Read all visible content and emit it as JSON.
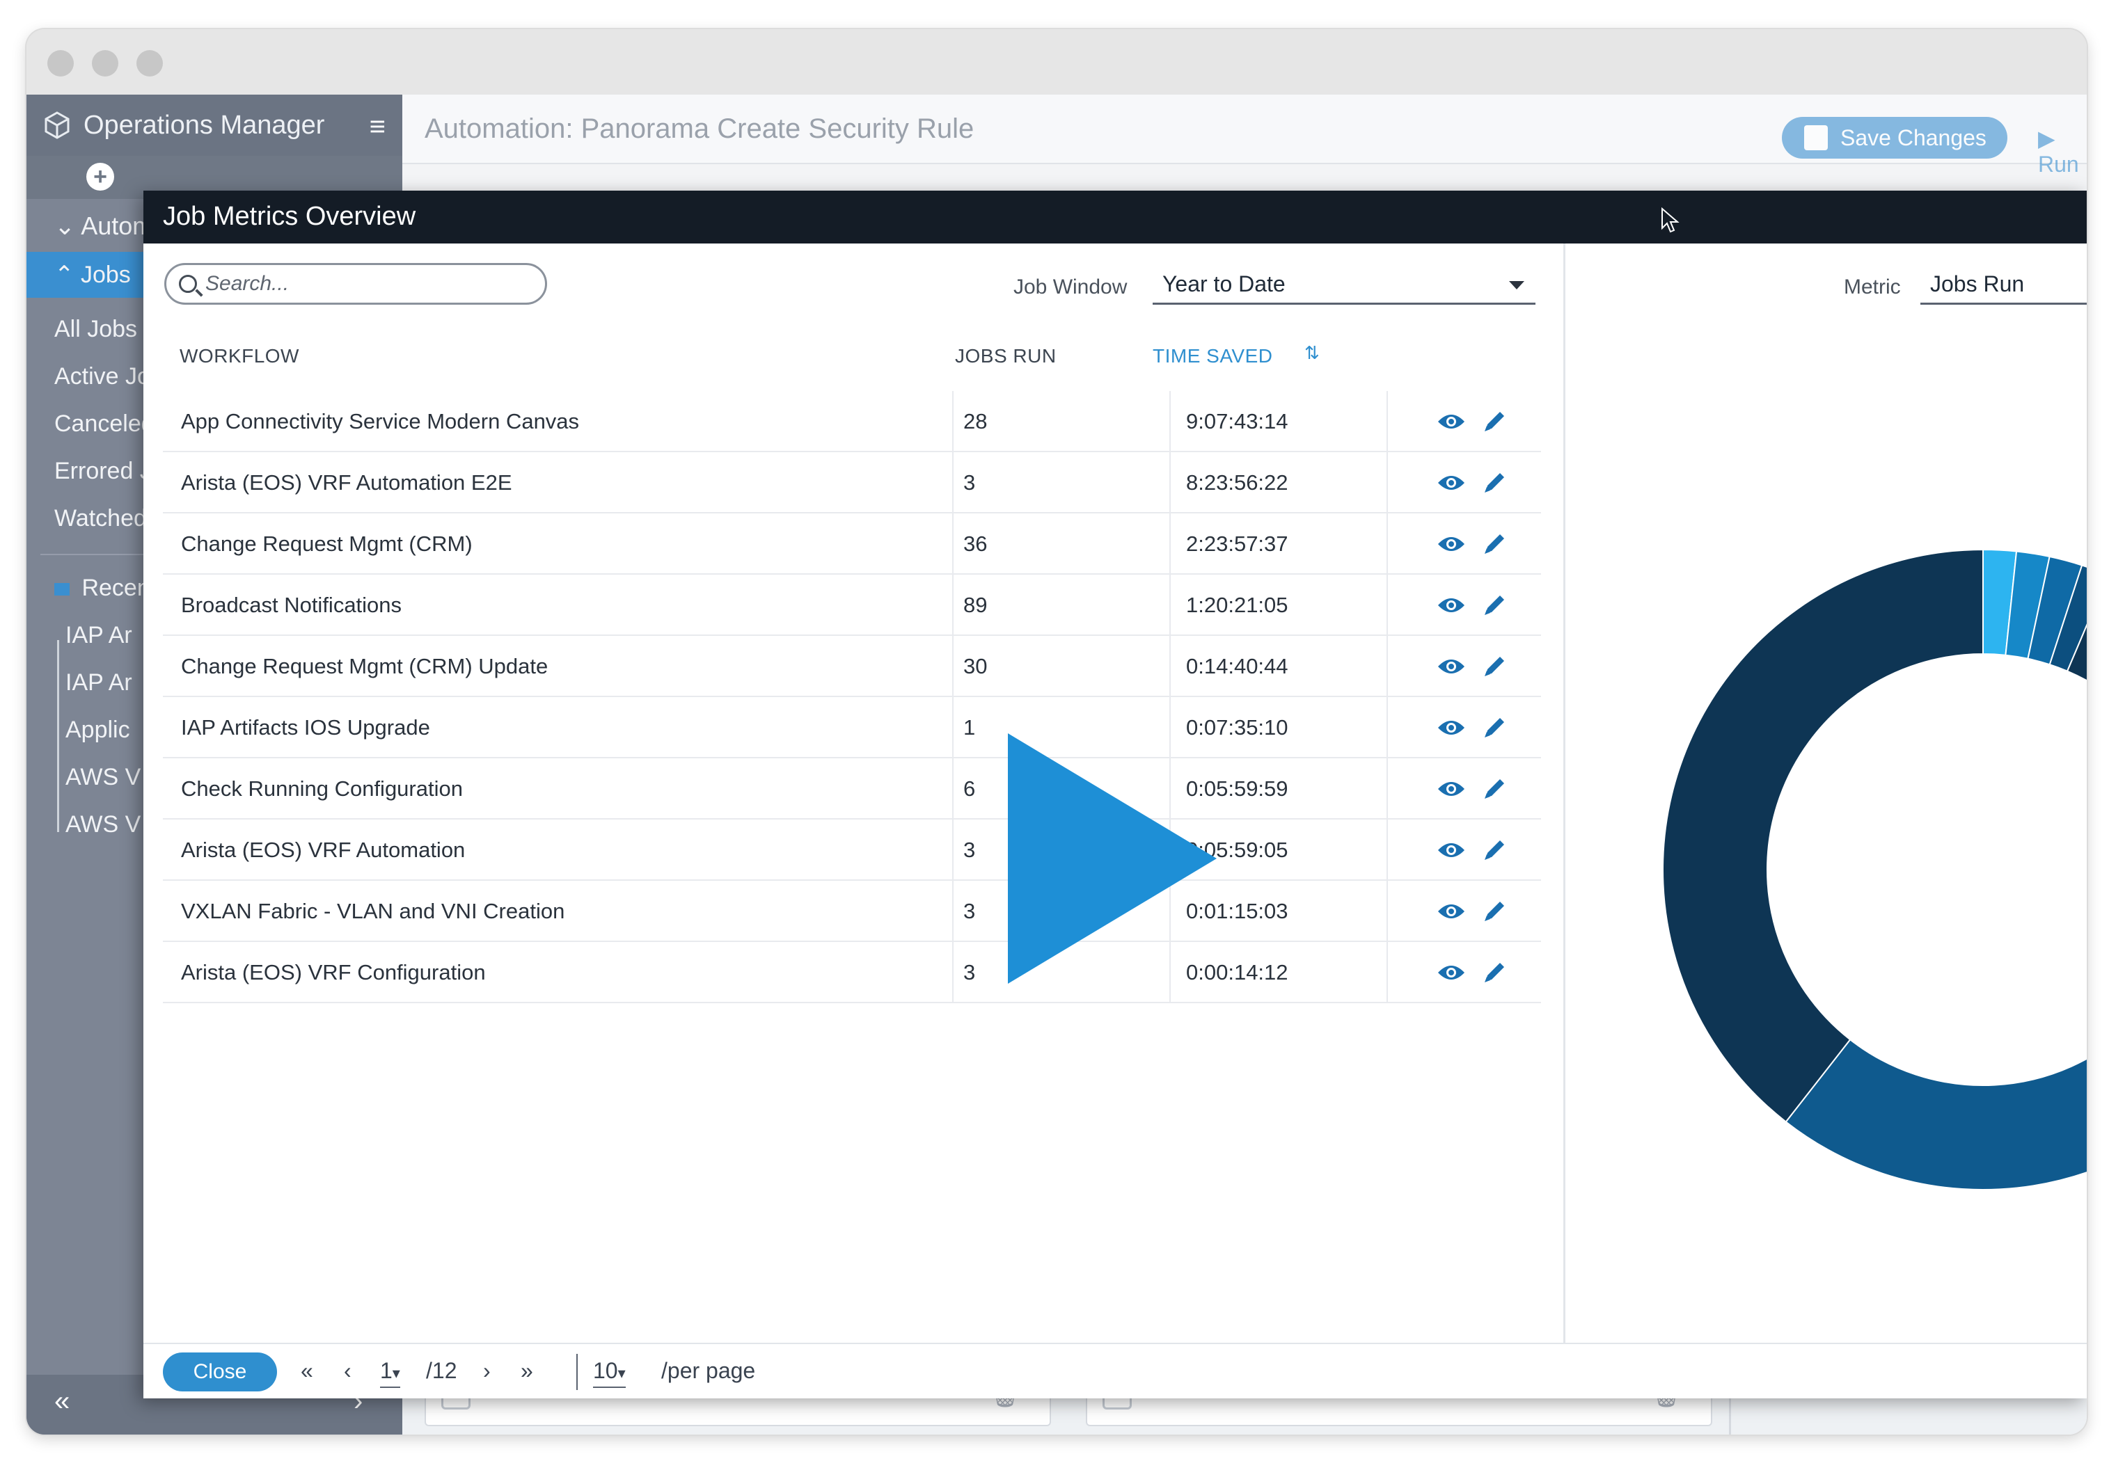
{
  "app": {
    "name": "Operations Manager",
    "page_title": "Automation: Panorama Create Security Rule"
  },
  "sidebar": {
    "section": "Autom",
    "jobs_label": "Jobs",
    "items": [
      {
        "label": "All Jobs"
      },
      {
        "label": "Active Jo"
      },
      {
        "label": "Canceled"
      },
      {
        "label": "Errored J"
      },
      {
        "label": "Watched"
      }
    ],
    "recent_label": "Recen",
    "recent_items": [
      {
        "label": "IAP Ar"
      },
      {
        "label": "IAP Ar"
      },
      {
        "label": "Applic"
      },
      {
        "label": "AWS V"
      },
      {
        "label": "AWS V"
      }
    ],
    "collapse_glyph": "«",
    "expand_glyph": "›"
  },
  "modal": {
    "title": "Job Metrics Overview",
    "search_placeholder": "Search...",
    "job_window_label": "Job Window",
    "job_window_value": "Year to Date",
    "columns": {
      "workflow": "WORKFLOW",
      "jobs_run": "JOBS RUN",
      "time_saved": "TIME SAVED"
    },
    "rows": [
      {
        "workflow": "App Connectivity Service Modern Canvas",
        "jobs_run": "28",
        "time_saved": "9:07:43:14"
      },
      {
        "workflow": "Arista (EOS) VRF Automation E2E",
        "jobs_run": "3",
        "time_saved": "8:23:56:22"
      },
      {
        "workflow": "Change Request Mgmt (CRM)",
        "jobs_run": "36",
        "time_saved": "2:23:57:37"
      },
      {
        "workflow": "Broadcast Notifications",
        "jobs_run": "89",
        "time_saved": "1:20:21:05"
      },
      {
        "workflow": "Change Request Mgmt (CRM) Update",
        "jobs_run": "30",
        "time_saved": "0:14:40:44"
      },
      {
        "workflow": "IAP Artifacts IOS Upgrade",
        "jobs_run": "1",
        "time_saved": "0:07:35:10"
      },
      {
        "workflow": "Check Running Configuration",
        "jobs_run": "6",
        "time_saved": "0:05:59:59"
      },
      {
        "workflow": "Arista (EOS) VRF Automation",
        "jobs_run": "3",
        "time_saved": "0:05:59:05"
      },
      {
        "workflow": "VXLAN Fabric - VLAN and VNI Creation",
        "jobs_run": "3",
        "time_saved": "0:01:15:03"
      },
      {
        "workflow": "Arista (EOS) VRF Configuration",
        "jobs_run": "3",
        "time_saved": "0:00:14:12"
      }
    ],
    "footer": {
      "close_label": "Close",
      "first_glyph": "«",
      "prev_glyph": "‹",
      "page": "1",
      "total_pages": "/12",
      "next_glyph": "›",
      "last_glyph": "»",
      "per_page_value": "10",
      "per_page_label": "/per page"
    },
    "metric_label": "Metric",
    "metric_value": "Jobs Run"
  },
  "bottom_bar": {
    "save_label": "Save Changes",
    "run_label": "Run"
  },
  "colors": {
    "accent": "#2f8fcf",
    "modal_header": "#141c26",
    "sidebar": "#7d8594",
    "donut_dark": "#0e3554",
    "donut_mid": "#0f5a8e",
    "donut_light": "#2db4f0"
  }
}
